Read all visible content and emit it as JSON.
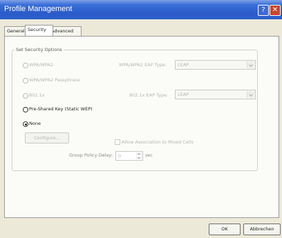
{
  "window": {
    "title": "Profile Management"
  },
  "titlebar_buttons": {
    "help": "?",
    "close": "✕"
  },
  "tabs": [
    {
      "label": "General",
      "active": false
    },
    {
      "label": "Security",
      "active": true
    },
    {
      "label": "Advanced",
      "active": false
    }
  ],
  "security": {
    "group_title": "Set Security Options",
    "options": [
      {
        "label": "WPA/WPA2",
        "enabled": false,
        "checked": false
      },
      {
        "label": "WPA/WPA2 Passphrase",
        "enabled": false,
        "checked": false
      },
      {
        "label": "802.1x",
        "enabled": false,
        "checked": false
      },
      {
        "label": "Pre-Shared Key (Static WEP)",
        "enabled": true,
        "checked": false
      },
      {
        "label": "None",
        "enabled": true,
        "checked": true
      }
    ],
    "wpa_eap_type": {
      "label": "WPA/WPA2 EAP Type:",
      "value": "LEAP"
    },
    "dot1x_eap_type": {
      "label": "802.1x EAP Type:",
      "value": "LEAP"
    },
    "configure_button": "Configure...",
    "allow_association": "Allow Association to Mixed Cells",
    "group_policy": {
      "label": "Group Policy Delay:",
      "value": "0",
      "unit": "sec"
    }
  },
  "footer": {
    "ok": "OK",
    "cancel": "Abbrechen"
  }
}
